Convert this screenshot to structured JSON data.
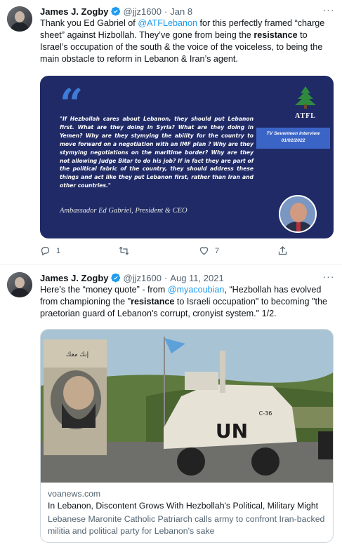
{
  "tweets": [
    {
      "author_name": "James J. Zogby",
      "handle": "@jjz1600",
      "separator": "·",
      "date": "Jan 8",
      "text_parts": {
        "p1": "Thank you Ed Gabriel of ",
        "mention": "@ATFLebanon",
        "p2": " for this perfectly framed “charge sheet” against Hizbollah. They’ve gone from being the ",
        "bold": "resistance",
        "p3": " to Israel’s occupation of the south & the voice of the voiceless, to being the main obstacle to reform in Lebanon & Iran’s agent."
      },
      "card": {
        "quote_mark": "“",
        "quote": "\"If Hezbollah cares about Lebanon, they should put Lebanon first. What are they doing in Syria? What are they doing in Yemen? Why are they stymying the ability for the country to move forward on a negotiation with an IMF plan ? Why are they stymying negotiations on the maritime border? Why are they not allowing Judge Bitar to do his job? If in fact they are part of the political fabric of the country, they should address these things and act like they put Lebanon first, rather than Iran and other countries.\"",
        "attribution": "Ambassador Ed Gabriel, President & CEO",
        "logo_text": "ATFL",
        "tv_line1": "TV Seventeen Interview",
        "tv_line2": "01/02/2022"
      },
      "actions": {
        "reply_count": "1",
        "retweet_count": "",
        "like_count": "7"
      }
    },
    {
      "author_name": "James J. Zogby",
      "handle": "@jjz1600",
      "separator": "·",
      "date": "Aug 11, 2021",
      "text_parts": {
        "p1": "Here’s the “money quote” - from ",
        "mention": "@myacoubian",
        "p2": ", “Hezbollah has evolved from championing the \"",
        "bold": "resistance",
        "p3": " to Israeli occupation\" to becoming \"the praetorian guard of Lebanon's corrupt, cronyist system.\"  1/2."
      },
      "link": {
        "domain": "voanews.com",
        "title": "In Lebanon, Discontent Grows With Hezbollah's Political, Military Might",
        "description": "Lebanese Maronite Catholic Patriarch calls army to confront Iran-backed militia and political party for Lebanon's sake"
      },
      "image_text": {
        "vehicle": "UN",
        "vehicle_id": "C-36",
        "banner": "إنك معك"
      }
    }
  ],
  "colors": {
    "link": "#1d9bf0",
    "muted": "#536471",
    "card_bg": "#1f2a66",
    "accent": "#3b64c7"
  }
}
